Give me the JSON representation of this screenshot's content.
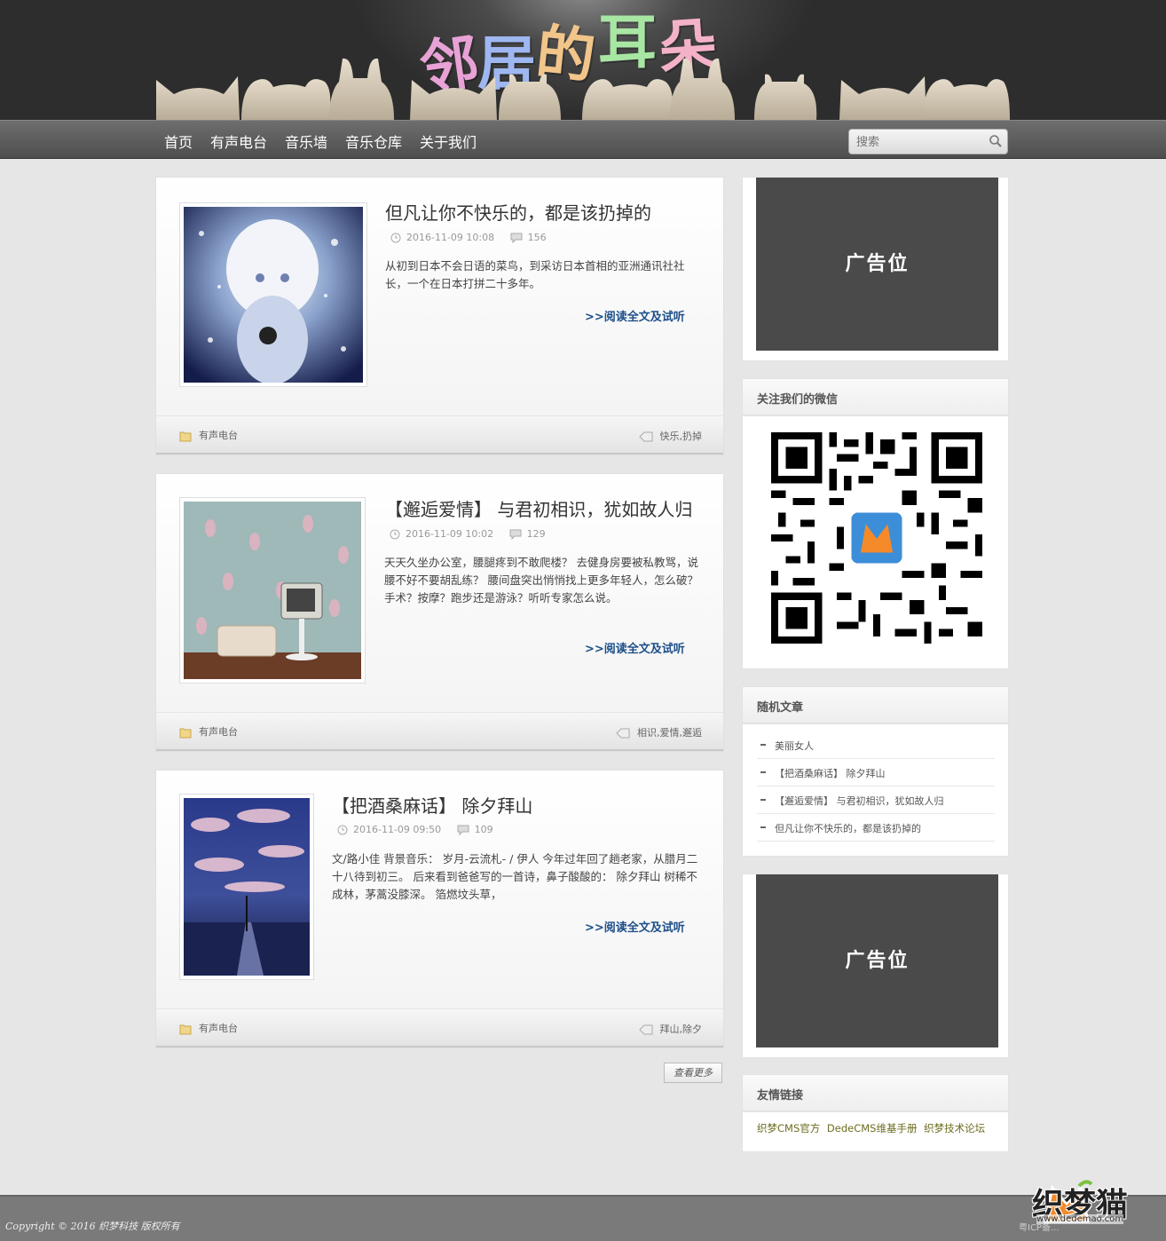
{
  "site": {
    "logo_chars": [
      "邻",
      "居",
      "的",
      "耳",
      "朵"
    ],
    "logo_colors": [
      "#e8a2d6",
      "#9fb7f1",
      "#f2c58a",
      "#a8e6a4",
      "#f4b2c9"
    ]
  },
  "nav": {
    "items": [
      "首页",
      "有声电台",
      "音乐墙",
      "音乐仓库",
      "关于我们"
    ],
    "search_placeholder": "搜索"
  },
  "posts": [
    {
      "title": "但凡让你不快乐的，都是该扔掉的",
      "date": "2016-11-09 10:08",
      "comments": "156",
      "excerpt": "从初到日本不会日语的菜鸟，到采访日本首相的亚洲通讯社社长，一个在日本打拼二十多年。",
      "read_more": ">>阅读全文及试听",
      "category": "有声电台",
      "tags": "快乐,扔掉"
    },
    {
      "title": "【邂逅爱情】 与君初相识，犹如故人归",
      "date": "2016-11-09 10:02",
      "comments": "129",
      "excerpt": "天天久坐办公室，腰腿疼到不敢爬楼？ 去健身房要被私教骂，说腰不好不要胡乱练？ 腰间盘突出悄悄找上更多年轻人，怎么破？ 手术？按摩？跑步还是游泳？听听专家怎么说。",
      "read_more": ">>阅读全文及试听",
      "category": "有声电台",
      "tags": "相识,爱情,邂逅"
    },
    {
      "title": "【把酒桑麻话】 除夕拜山",
      "date": "2016-11-09 09:50",
      "comments": "109",
      "excerpt": "文/路小佳 背景音乐： 岁月-云流札- / 伊人 今年过年回了趟老家，从腊月二十八待到初三。 后来看到爸爸写的一首诗，鼻子酸酸的： 除夕拜山 树稀不成林，茅蒿没膝深。 箔燃坟头草，",
      "read_more": ">>阅读全文及试听",
      "category": "有声电台",
      "tags": "拜山,除夕"
    }
  ],
  "more_button": "查看更多",
  "sidebar": {
    "ad_label": "广告位",
    "wechat_title": "关注我们的微信",
    "random_title": "随机文章",
    "random_items": [
      "美丽女人",
      "【把酒桑麻话】 除夕拜山",
      "【邂逅爱情】 与君初相识，犹如故人归",
      "但凡让你不快乐的，都是该扔掉的"
    ],
    "links_title": "友情链接",
    "links": [
      "织梦CMS官方",
      "DedeCMS维基手册",
      "织梦技术论坛"
    ]
  },
  "footer": {
    "copyright": "Copyright © 2016 织梦科技 版权所有",
    "icp": "粤ICP备..."
  },
  "watermark": {
    "brand": "织梦猫",
    "url": "www.dedemao.com"
  },
  "colors": {
    "accent_link": "#1d4f8a",
    "ad_bg": "#4a4a4a",
    "nav_bg": "#5a5a5a"
  }
}
